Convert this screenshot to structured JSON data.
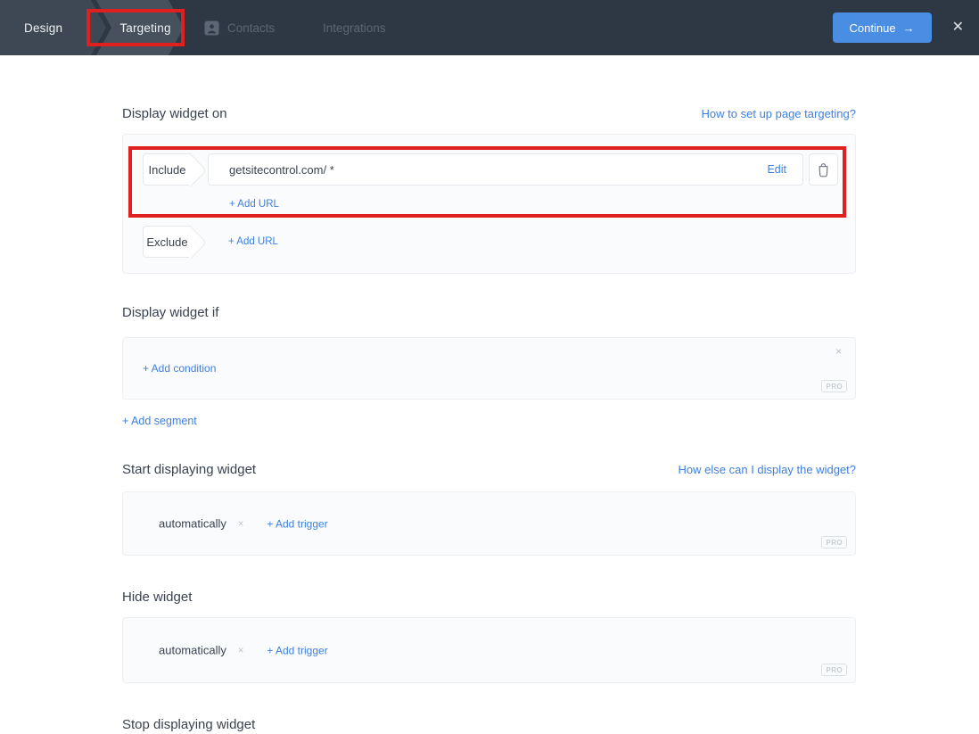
{
  "navbar": {
    "tabs": [
      {
        "label": "Design"
      },
      {
        "label": "Targeting"
      },
      {
        "label": "Contacts"
      },
      {
        "label": "Integrations"
      }
    ],
    "continue_label": "Continue",
    "continue_arrow": "→",
    "close_icon": "✕"
  },
  "annotations": {
    "highlight_color": "#e01f1f",
    "highlighted_elements": [
      "targeting-tab",
      "include-url-row"
    ]
  },
  "colors": {
    "navbar_bg": "#2e3744",
    "active_tab_bg": "#47515e",
    "link_blue": "#3f80de",
    "button_blue": "#4a8ee4",
    "annotation_red": "#e01f1f",
    "panel_bg": "#fafbfc"
  },
  "page": {
    "display_on": {
      "title": "Display widget on",
      "help_link": "How to set up page targeting?",
      "include_label": "Include",
      "include_url": "getsitecontrol.com/ *",
      "edit_label": "Edit",
      "add_url_label": "+ Add URL",
      "exclude_label": "Exclude",
      "exclude_add_url_label": "+ Add URL"
    },
    "display_if": {
      "title": "Display widget if",
      "add_condition_label": "+ Add condition",
      "close_icon": "×",
      "pro_label": "PRO"
    },
    "add_segment_label": "+ Add segment",
    "start_displaying": {
      "title": "Start displaying widget",
      "help_link": "How else can I display the widget?",
      "trigger_value": "automatically",
      "remove_icon": "×",
      "add_trigger_label": "+ Add trigger",
      "pro_label": "PRO"
    },
    "hide_widget": {
      "title": "Hide widget",
      "trigger_value": "automatically",
      "remove_icon": "×",
      "add_trigger_label": "+ Add trigger",
      "pro_label": "PRO"
    },
    "stop_displaying": {
      "title": "Stop displaying widget"
    }
  }
}
